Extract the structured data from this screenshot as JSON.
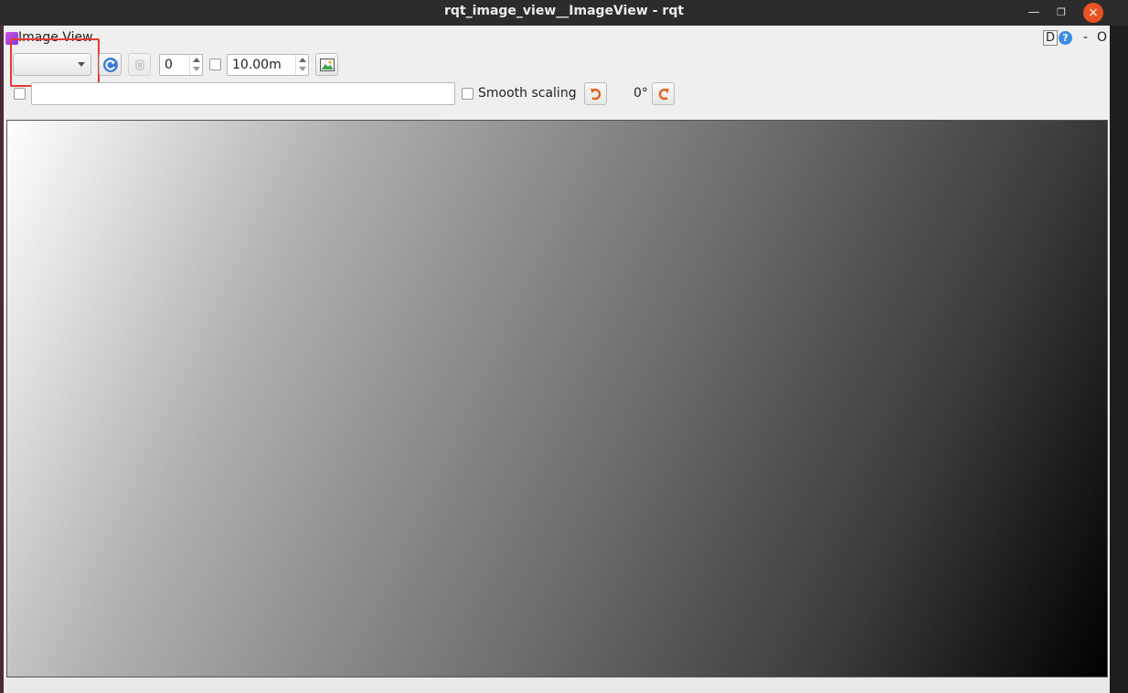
{
  "window": {
    "title": "rqt_image_view__ImageView - rqt"
  },
  "dock": {
    "title": "Image View",
    "d_label": "D",
    "help_label": "?",
    "min_label": "-",
    "close_label": "O"
  },
  "toolbar": {
    "topic_selected": "",
    "frame_index": "0",
    "timeout": "10.00m",
    "input_value": "",
    "smooth_scaling_label": "Smooth scaling",
    "rotation_label": "0°"
  },
  "icons": [
    "refresh-icon",
    "pause-icon",
    "save-image-icon",
    "rotate-left-icon",
    "rotate-right-icon"
  ],
  "colors": {
    "accent_close": "#e95420",
    "highlight": "#e53935",
    "help": "#3a8ee6"
  }
}
